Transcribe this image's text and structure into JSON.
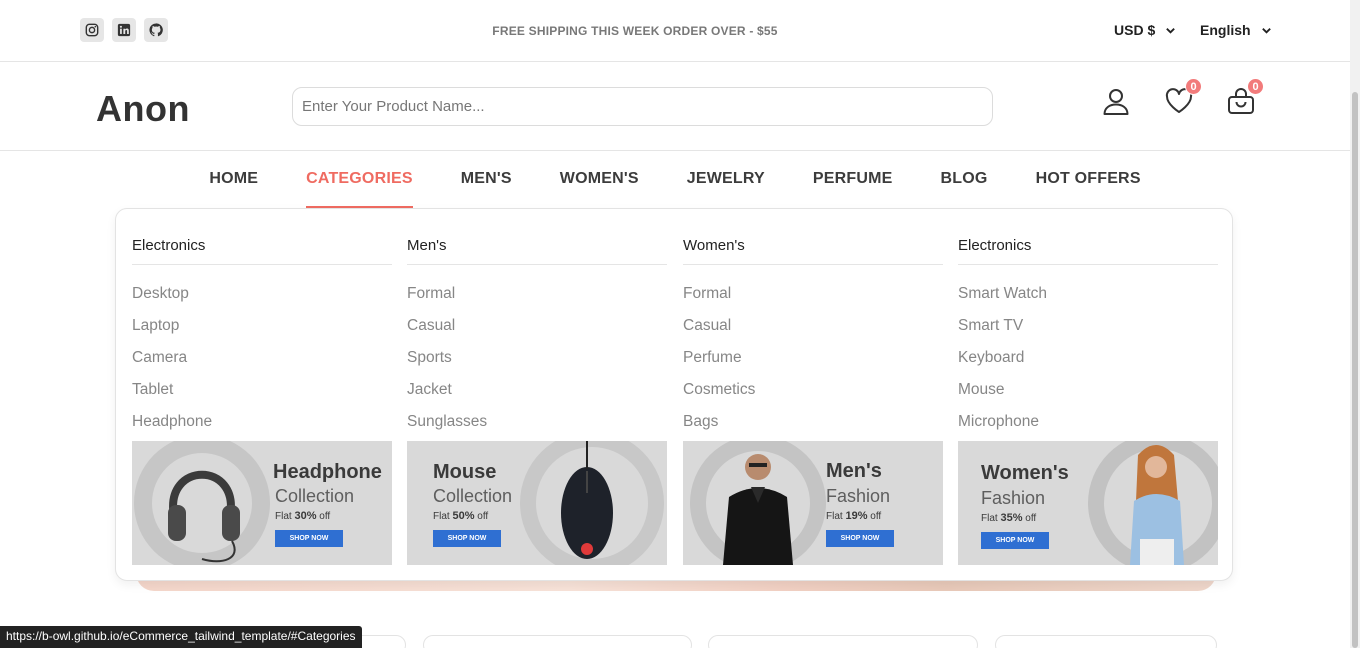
{
  "topbar": {
    "shipping": "FREE SHIPPING THIS WEEK ORDER OVER - $55",
    "currency": "USD $",
    "language": "English",
    "social": [
      "instagram-icon",
      "linkedin-icon",
      "github-icon"
    ]
  },
  "header": {
    "logo": "Anon",
    "search_placeholder": "Enter Your Product Name...",
    "wishlist_count": "0",
    "cart_count": "0"
  },
  "nav": {
    "items": [
      "HOME",
      "CATEGORIES",
      "MEN'S",
      "WOMEN'S",
      "JEWELRY",
      "PERFUME",
      "BLOG",
      "HOT OFFERS"
    ],
    "active": "CATEGORIES"
  },
  "dropdown": {
    "columns": [
      {
        "title": "Electronics",
        "items": [
          "Desktop",
          "Laptop",
          "Camera",
          "Tablet",
          "Headphone"
        ],
        "banner": {
          "title": "Headphone",
          "sub": "Collection",
          "flat_pre": "Flat ",
          "discount": "30%",
          "flat_post": " off",
          "button": "SHOP NOW"
        }
      },
      {
        "title": "Men's",
        "items": [
          "Formal",
          "Casual",
          "Sports",
          "Jacket",
          "Sunglasses"
        ],
        "banner": {
          "title": "Mouse",
          "sub": "Collection",
          "flat_pre": "Flat ",
          "discount": "50%",
          "flat_post": " off",
          "button": "SHOP NOW"
        }
      },
      {
        "title": "Women's",
        "items": [
          "Formal",
          "Casual",
          "Perfume",
          "Cosmetics",
          "Bags"
        ],
        "banner": {
          "title": "Men's",
          "sub": "Fashion",
          "flat_pre": "Flat ",
          "discount": "19%",
          "flat_post": " off",
          "button": "SHOP NOW"
        }
      },
      {
        "title": "Electronics",
        "items": [
          "Smart Watch",
          "Smart TV",
          "Keyboard",
          "Mouse",
          "Microphone"
        ],
        "banner": {
          "title": "Women's",
          "sub": "Fashion",
          "flat_pre": "Flat ",
          "discount": "35%",
          "flat_post": " off",
          "button": "SHOP NOW"
        }
      }
    ]
  },
  "status_url": "https://b-owl.github.io/eCommerce_tailwind_template/#Categories",
  "colors": {
    "accent": "#ef6b61",
    "badge": "#f27b7b",
    "shop_button": "#2f6fd2"
  }
}
